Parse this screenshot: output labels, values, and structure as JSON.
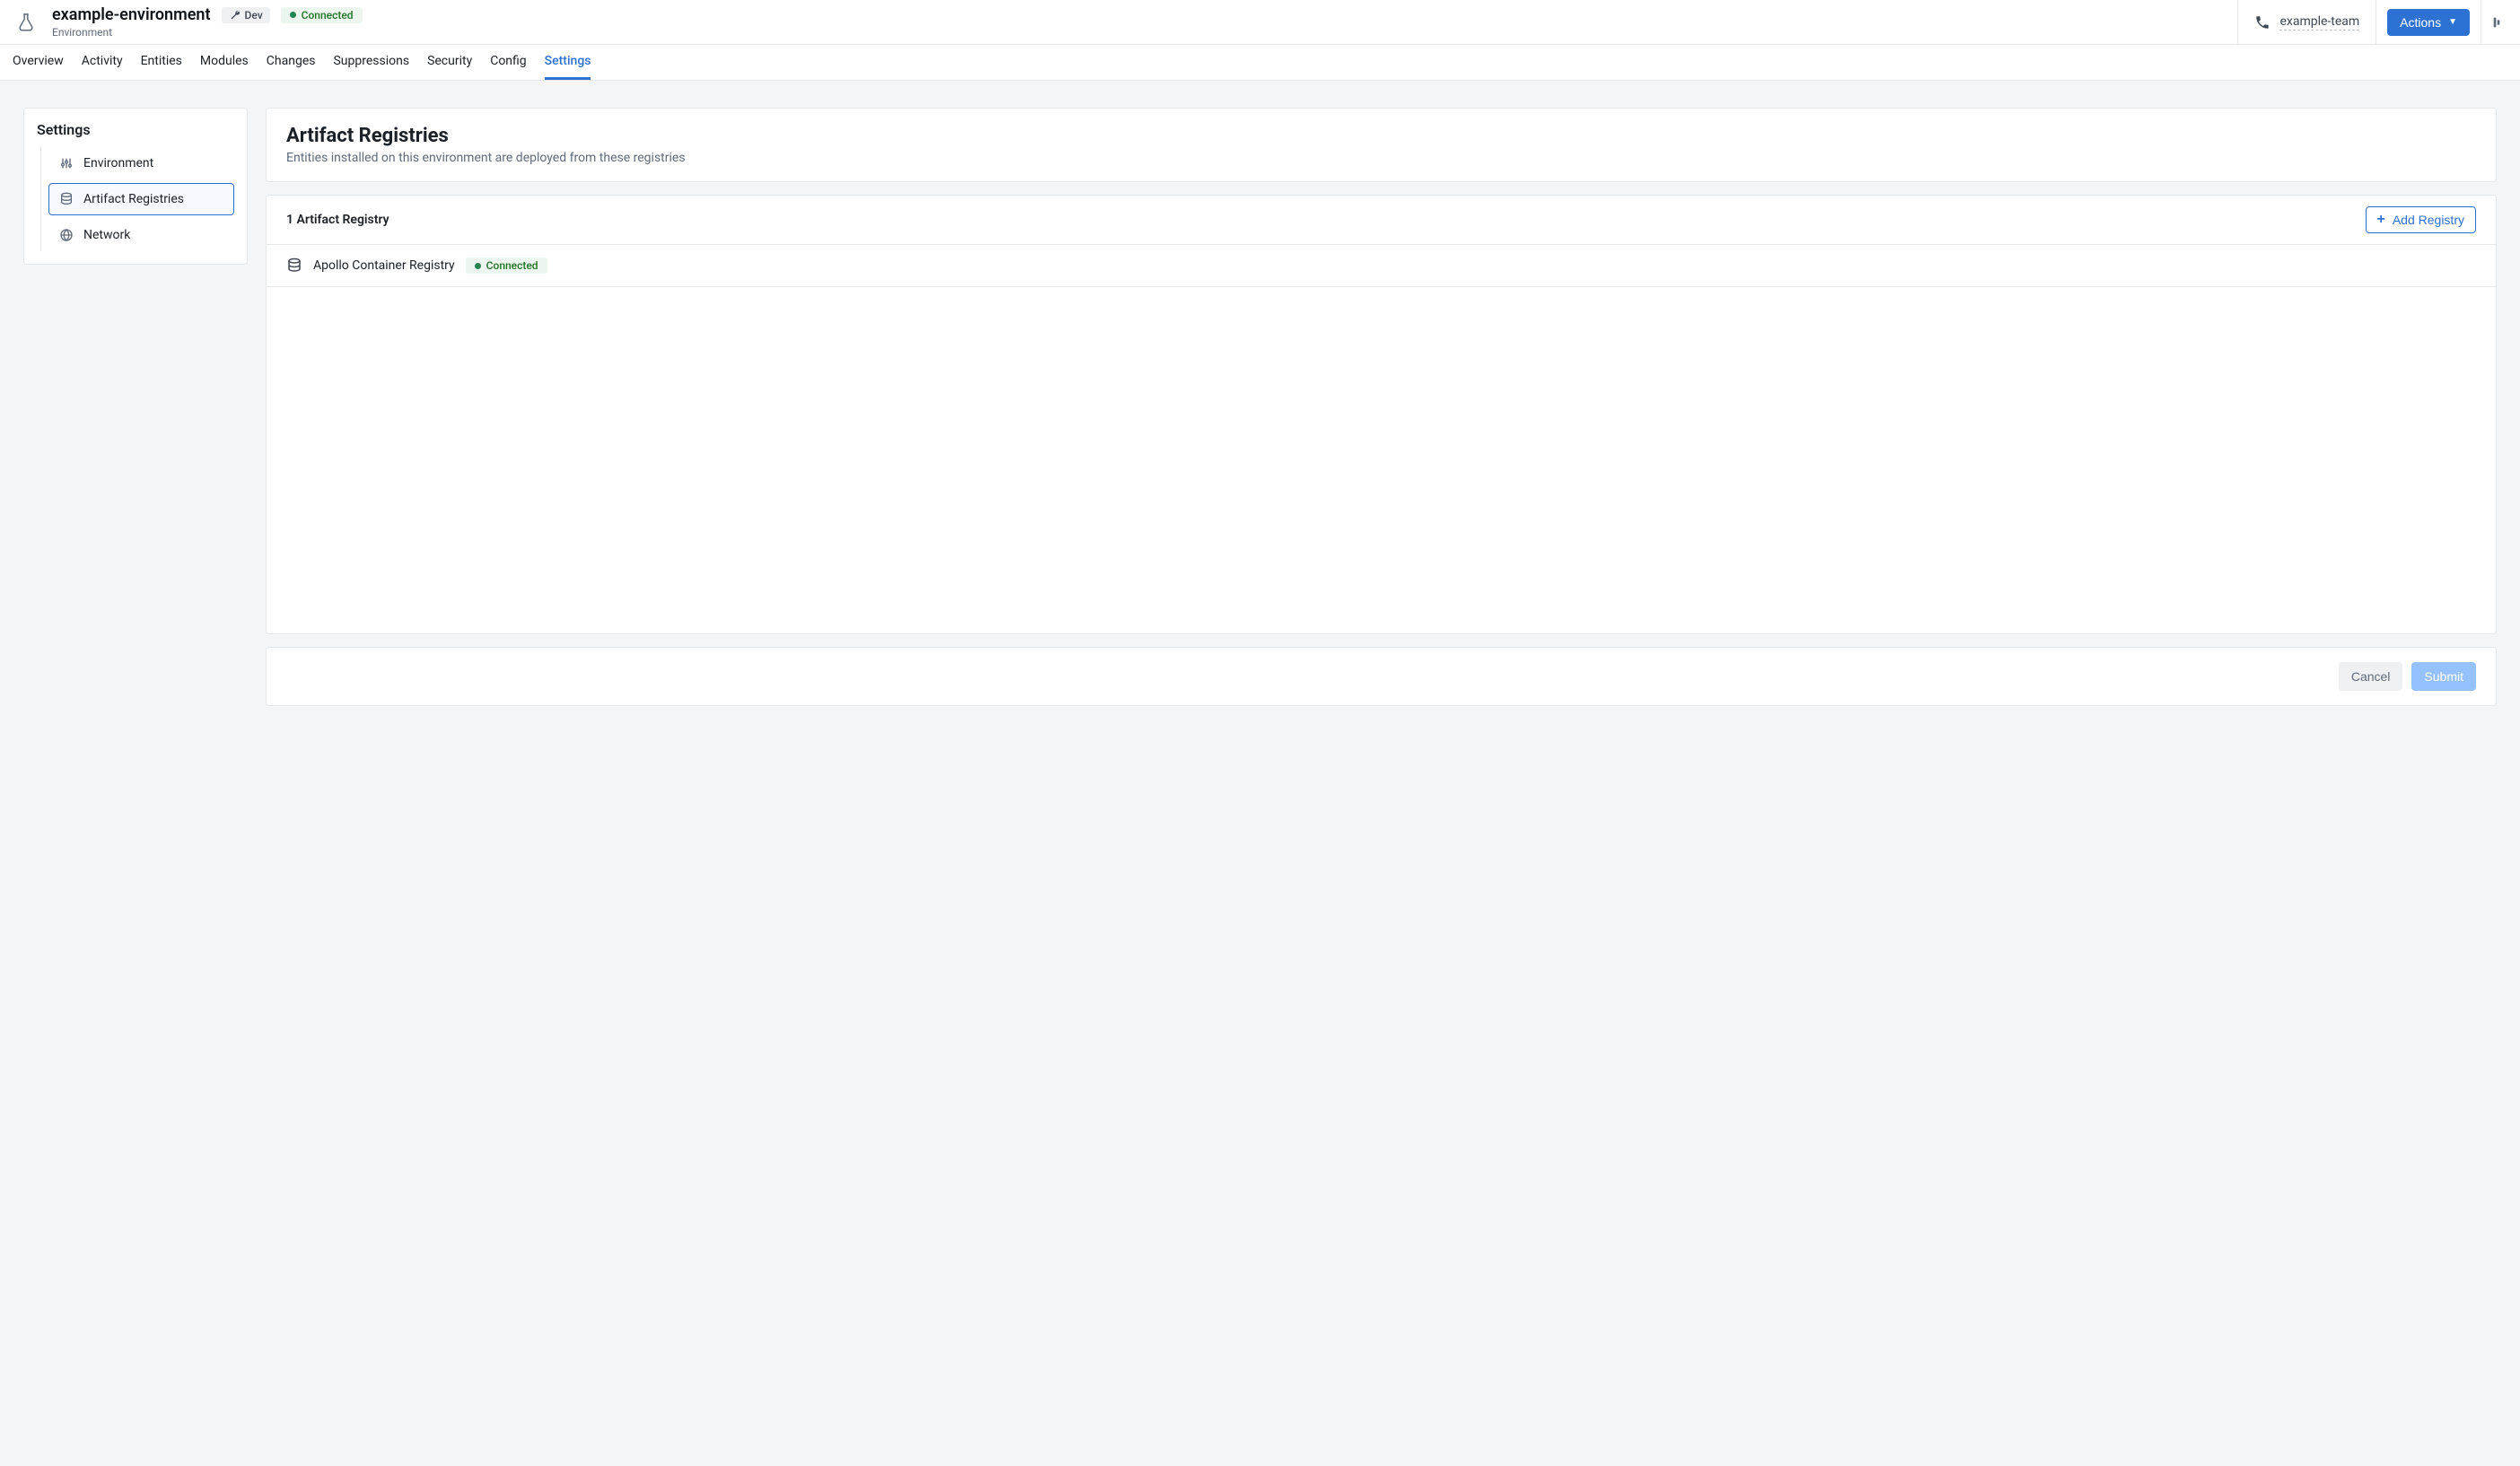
{
  "header": {
    "title": "example-environment",
    "subtitle": "Environment",
    "dev_badge": "Dev",
    "status": "Connected",
    "team_name": "example-team",
    "actions_label": "Actions"
  },
  "tabs": {
    "items": [
      {
        "label": "Overview"
      },
      {
        "label": "Activity"
      },
      {
        "label": "Entities"
      },
      {
        "label": "Modules"
      },
      {
        "label": "Changes"
      },
      {
        "label": "Suppressions"
      },
      {
        "label": "Security"
      },
      {
        "label": "Config"
      },
      {
        "label": "Settings",
        "active": true
      }
    ]
  },
  "sidebar": {
    "title": "Settings",
    "items": [
      {
        "label": "Environment",
        "icon": "sliders-icon"
      },
      {
        "label": "Artifact Registries",
        "icon": "database-icon",
        "active": true
      },
      {
        "label": "Network",
        "icon": "globe-icon"
      }
    ]
  },
  "content": {
    "page_title": "Artifact Registries",
    "page_sub": "Entities installed on this environment are deployed from these registries",
    "count_label": "1 Artifact Registry",
    "add_label": "Add Registry",
    "registries": [
      {
        "name": "Apollo Container Registry",
        "status": "Connected"
      }
    ]
  },
  "footer": {
    "cancel": "Cancel",
    "submit": "Submit"
  }
}
